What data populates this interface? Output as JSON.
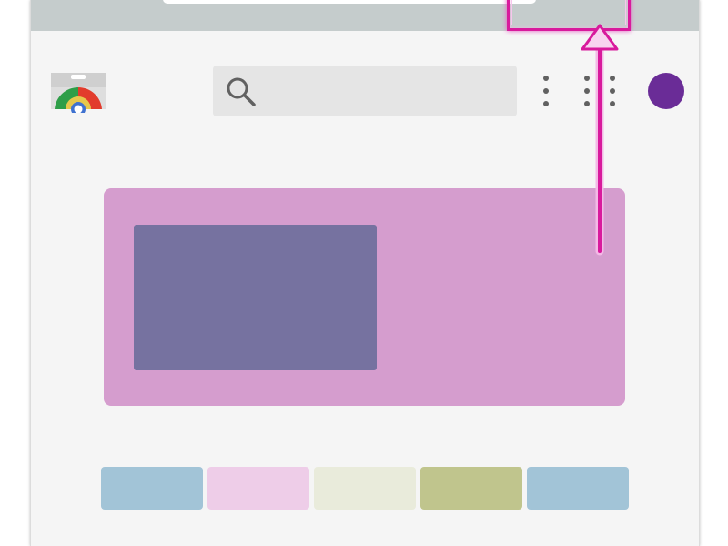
{
  "browser": {
    "omnibox_placeholder": ""
  },
  "header": {
    "logo_icon": "web-store-icon",
    "search": {
      "icon": "search-icon",
      "placeholder": "",
      "value": ""
    },
    "menu_icon": "more-vert-icon",
    "apps_icon": "apps-grid-icon",
    "avatar_color": "#6a2c97"
  },
  "banner": {
    "background": "#d59dce",
    "image_color": "#7672a0"
  },
  "cards": [
    {
      "color": "#a2c4d7"
    },
    {
      "color": "#eecde8"
    },
    {
      "color": "#e9ebdb"
    },
    {
      "color": "#c0c58d"
    },
    {
      "color": "#a2c4d7"
    }
  ],
  "annotation": {
    "color": "#d81a9c",
    "glow": "#f4b8e6"
  }
}
